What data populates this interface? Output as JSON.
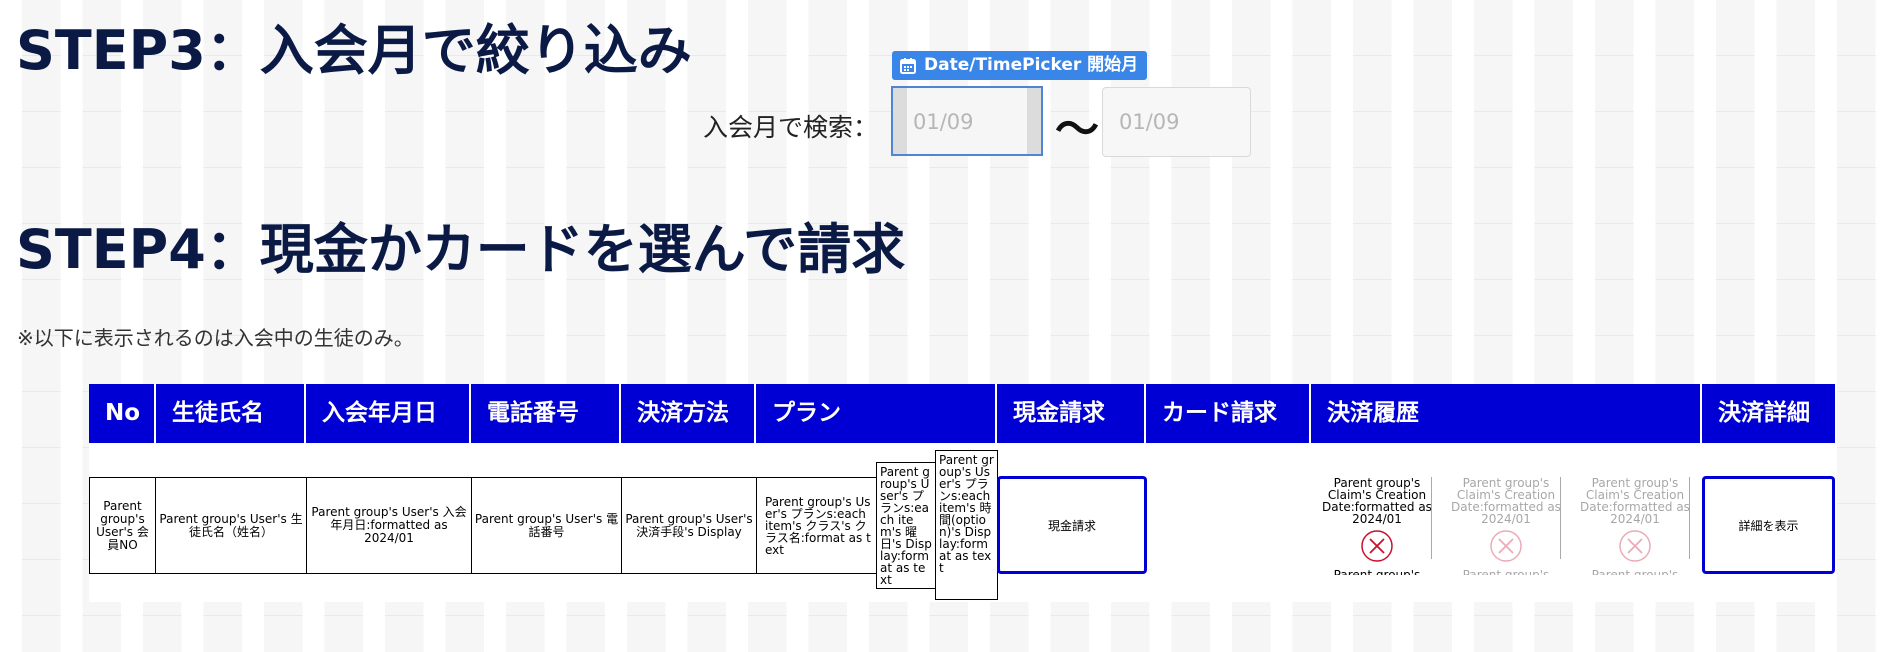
{
  "step3": {
    "title": "STEP3：入会月で絞り込み"
  },
  "filter": {
    "label": "入会月で検索：",
    "picker_badge": "Date/TimePicker 開始月",
    "start_placeholder": "01/09",
    "separator": "〜",
    "end_placeholder": "01/09"
  },
  "step4": {
    "title": "STEP4：現金かカードを選んで請求"
  },
  "note": "※以下に表示されるのは入会中の生徒のみ。",
  "table": {
    "headers": [
      "No",
      "生徒氏名",
      "入会年月日",
      "電話番号",
      "決済方法",
      "プラン",
      "現金請求",
      "カード請求",
      "決済履歴",
      "決済詳細"
    ],
    "row": {
      "no": "Parent group's User's 会員NO",
      "name": "Parent group's User's 生徒氏名（姓名）",
      "joined": "Parent group's User's 入会年月日:formatted as 2024/01",
      "phone": "Parent group's User's 電話番号",
      "payment": "Parent group's User's 決済手段's Display",
      "plan": "Parent group's User's プランs:each item's クラス's クラス名:format as text",
      "plan_day": "Parent group's User's プランs:each item's 曜日's Display:format as text",
      "plan_time": "Parent group's User's プランs:each item's 時間(option)'s Display:format as text",
      "cash_button": "現金請求",
      "history": [
        {
          "text": "Parent group's Claim's Creation Date:formatted as 2024/01",
          "cut": "Parent group's"
        },
        {
          "text": "Parent group's Claim's Creation Date:formatted as 2024/01",
          "cut": "Parent group's"
        },
        {
          "text": "Parent group's Claim's Creation Date:formatted as 2024/01",
          "cut": "Parent group's"
        }
      ],
      "detail_button": "詳細を表示"
    }
  },
  "colors": {
    "header_bg": "#0000d4",
    "title": "#0b1a45",
    "badge": "#3a86e8",
    "x_icon": "#c8102e"
  }
}
